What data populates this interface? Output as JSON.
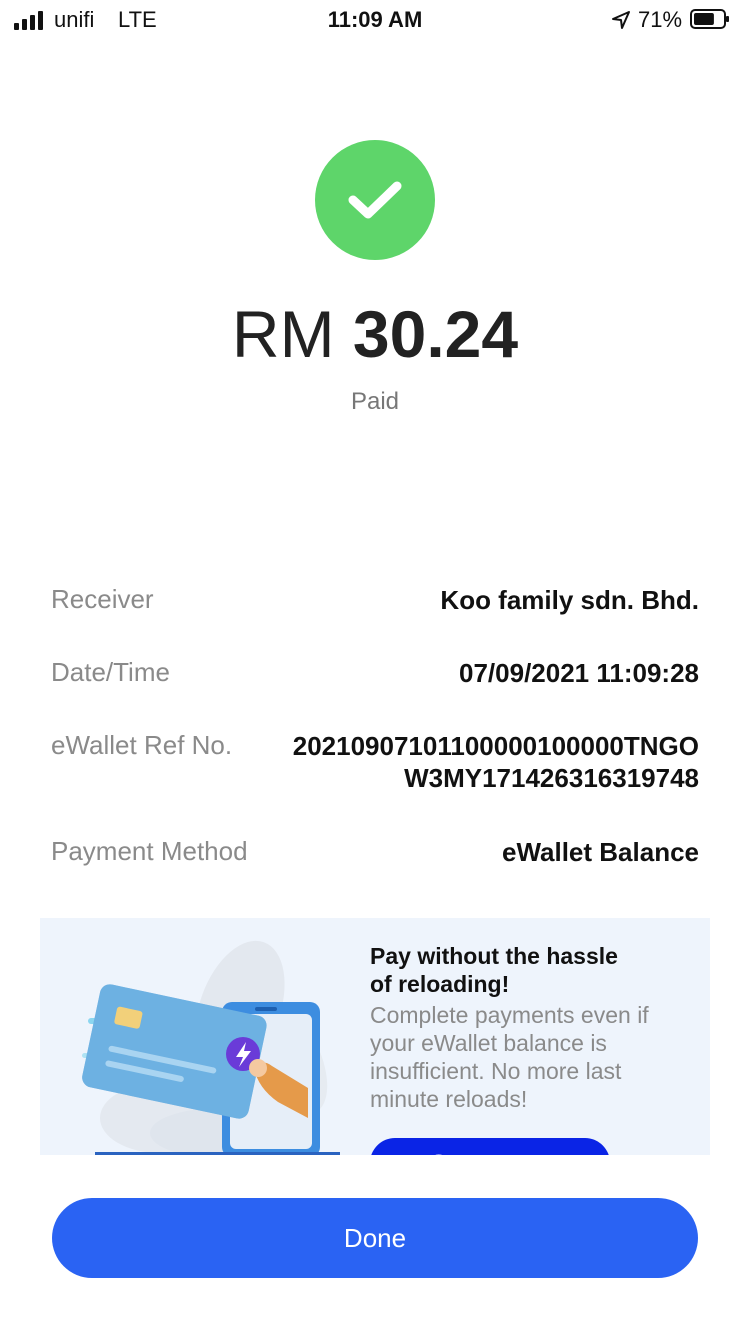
{
  "status_bar": {
    "carrier": "unifi",
    "network": "LTE",
    "time": "11:09 AM",
    "battery": "71%",
    "battery_level": 0.71
  },
  "payment": {
    "currency": "RM",
    "amount": "30.24",
    "status": "Paid"
  },
  "details": [
    {
      "label": "Receiver",
      "value": "Koo family sdn. Bhd."
    },
    {
      "label": "Date/Time",
      "value": "07/09/2021 11:09:28"
    },
    {
      "label": "eWallet Ref No.",
      "value_line1": "20210907101100000100000TNGO",
      "value_line2": "W3MY171426316319748"
    },
    {
      "label": "Payment Method",
      "value": "eWallet Balance"
    }
  ],
  "promo": {
    "title_line1": "Pay without the hassle",
    "title_line2": "of reloading!",
    "text_line1": "Complete payments even if",
    "text_line2": "your eWallet balance is",
    "text_line3": "insufficient. No more last",
    "text_line4": "minute reloads!",
    "button_label": "Set up now"
  },
  "done_label": "Done",
  "colors": {
    "success": "#5ed56a",
    "primary": "#2a63f3",
    "promo_button": "#0a24e6",
    "promo_bg": "#eef4fc"
  }
}
